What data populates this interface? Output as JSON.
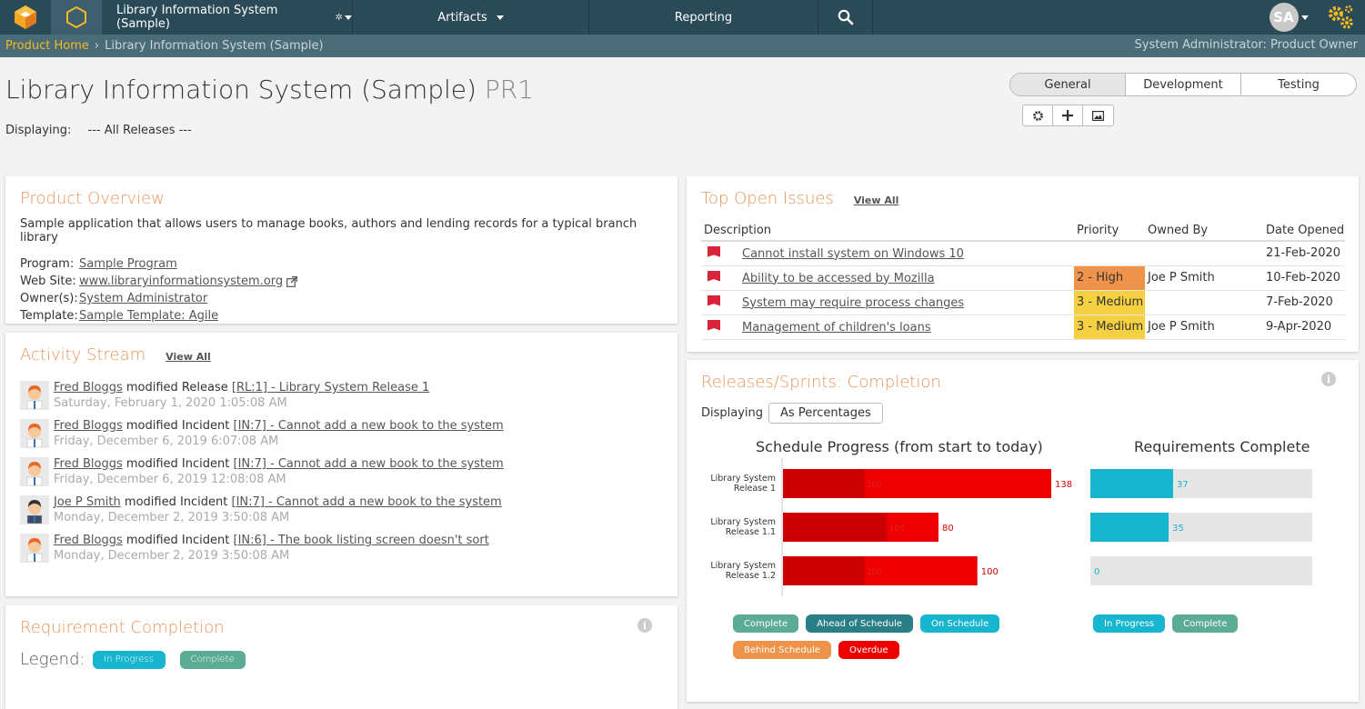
{
  "topbar": {
    "project_name": "Library Information System (Sample)",
    "artifacts_label": "Artifacts",
    "reporting_label": "Reporting",
    "user_initials": "SA"
  },
  "breadcrumb": {
    "home": "Product Home",
    "current": "Library Information System (Sample)",
    "role": "System Administrator: Product Owner"
  },
  "header": {
    "title": "Library Information System (Sample)",
    "code": "PR1",
    "displaying_label": "Displaying:",
    "displaying_value": "--- All Releases ---",
    "tabs": [
      "General",
      "Development",
      "Testing"
    ]
  },
  "overview": {
    "title": "Product Overview",
    "description": "Sample application that allows users to manage books, authors and lending records for a typical branch library",
    "rows": [
      {
        "label": "Program:",
        "value": "Sample Program"
      },
      {
        "label": "Web Site:",
        "value": "www.libraryinformationsystem.org"
      },
      {
        "label": "Owner(s):",
        "value": "System Administrator"
      },
      {
        "label": "Template:",
        "value": "Sample Template: Agile"
      }
    ]
  },
  "activity": {
    "title": "Activity Stream",
    "view_all": "View All",
    "items": [
      {
        "user": "Fred Bloggs",
        "action": "modified Release",
        "ref": "[RL:1]",
        "text": " - Library System Release 1",
        "time": "Saturday, February 1, 2020 1:05:08 AM"
      },
      {
        "user": "Fred Bloggs",
        "action": "modified Incident",
        "ref": "[IN:7]",
        "text": " - Cannot add a new book to the system",
        "time": "Friday, December 6, 2019 6:07:08 AM"
      },
      {
        "user": "Fred Bloggs",
        "action": "modified Incident",
        "ref": "[IN:7]",
        "text": " - Cannot add a new book to the system",
        "time": "Friday, December 6, 2019 12:08:08 AM"
      },
      {
        "user": "Joe P Smith",
        "action": "modified Incident",
        "ref": "[IN:7]",
        "text": " - Cannot add a new book to the system",
        "time": "Monday, December 2, 2019 3:50:08 AM"
      },
      {
        "user": "Fred Bloggs",
        "action": "modified Incident",
        "ref": "[IN:6]",
        "text": " - The book listing screen doesn't sort",
        "time": "Monday, December 2, 2019 3:50:08 AM"
      }
    ]
  },
  "req_completion": {
    "title": "Requirement Completion",
    "legend_label": "Legend:",
    "legend": [
      "In Progress",
      "Complete"
    ]
  },
  "issues": {
    "title": "Top Open Issues",
    "view_all": "View All",
    "headers": [
      "Description",
      "Priority",
      "Owned By",
      "Date Opened"
    ],
    "rows": [
      {
        "description": "Cannot install system on Windows 10",
        "priority": "",
        "owner": "",
        "date": "21-Feb-2020"
      },
      {
        "description": "Ability to be accessed by Mozilla",
        "priority": "2 - High",
        "owner": "Joe P Smith",
        "date": "10-Feb-2020"
      },
      {
        "description": "System may require process changes",
        "priority": "3 - Medium",
        "owner": "",
        "date": "7-Feb-2020"
      },
      {
        "description": "Management of children's loans",
        "priority": "3 - Medium",
        "owner": "Joe P Smith",
        "date": "9-Apr-2020"
      }
    ]
  },
  "releases": {
    "title": "Releases/Sprints: Completion",
    "displaying_label": "Displaying",
    "displaying_value": "As Percentages",
    "schedule_legend": [
      "Complete",
      "Ahead of Schedule",
      "On Schedule",
      "Behind Schedule",
      "Overdue"
    ],
    "req_legend": [
      "In Progress",
      "Complete"
    ]
  },
  "colors": {
    "accent_orange": "#e8945a",
    "topbar": "#2a4a57",
    "complete": "#5bab95",
    "ahead": "#2a7f86",
    "on_schedule": "#18b5cf",
    "behind": "#f0934a",
    "overdue": "#ee0000",
    "in_progress": "#18b5cf"
  },
  "chart_data": [
    {
      "type": "bar",
      "title": "Schedule Progress (from start to today)",
      "categories": [
        "Library System Release 1",
        "Library System Release 1.1",
        "Library System Release 1.2"
      ],
      "series": [
        {
          "name": "",
          "values": [
            100,
            100,
            100
          ]
        },
        {
          "name": "",
          "values": [
            138,
            80,
            100
          ]
        }
      ],
      "labels": [
        "138",
        "80",
        "100"
      ],
      "inner_labels": [
        "100",
        "100",
        "100"
      ],
      "xlim": [
        0,
        200
      ]
    },
    {
      "type": "bar",
      "title": "Requirements Complete",
      "categories": [
        "Library System Release 1",
        "Library System Release 1.1",
        "Library System Release 1.2"
      ],
      "values": [
        37,
        35,
        0
      ],
      "xlim": [
        0,
        100
      ]
    }
  ]
}
